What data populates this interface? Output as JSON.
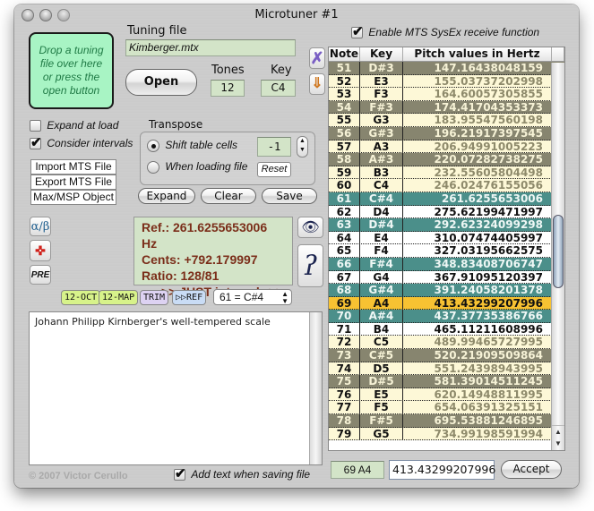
{
  "window": {
    "title": "Microtuner #1"
  },
  "dropzone": {
    "text": "Drop a tuning file over here or press the open button"
  },
  "tuning_file": {
    "label": "Tuning file",
    "value": "Kimberger.mtx",
    "open_label": "Open",
    "tones_label": "Tones",
    "tones_value": "12",
    "key_label": "Key",
    "key_value": "C4"
  },
  "side_icons": {
    "clear_icon": "x-icon",
    "download_icon": "down-arrow-icon"
  },
  "mts": {
    "enable_label": "Enable MTS SysEx receive function",
    "enable_checked": true
  },
  "options": {
    "expand_at_load_label": "Expand at load",
    "expand_at_load_checked": false,
    "consider_intervals_label": "Consider intervals",
    "consider_intervals_checked": true,
    "import_mts": "Import MTS File",
    "export_mts": "Export MTS File",
    "maxmsp": "Max/MSP Object"
  },
  "transpose": {
    "label": "Transpose",
    "shift_label": "Shift table cells",
    "shift_selected": true,
    "loading_label": "When loading file",
    "value": "-1",
    "reset_label": "Reset"
  },
  "actions": {
    "expand": "Expand",
    "clear": "Clear",
    "save": "Save"
  },
  "info": {
    "ref": "Ref.: 261.6255653006 Hz",
    "cents": "Cents: +792.179997",
    "ratio": "Ratio: 128/81",
    "interval": ">> JUST interval <<"
  },
  "left_tools": {
    "alpha_beta": "α/β",
    "pre": "PRE"
  },
  "mini_buttons": {
    "oct": "12-OCT",
    "map": "12-MAP",
    "trim": "TRIM",
    "ref": "▷▷REF",
    "ref_select": "61 = C#4"
  },
  "colors": {
    "mini_green": "#d7f28a",
    "mini_purple": "#ddd2f2",
    "mini_blue": "#c9dcf5",
    "info_text": "#7b2e1a",
    "teal_row": "#4b8f8a",
    "dim_acc_row": "#87856f",
    "selected_row": "#f7c232"
  },
  "description": "Johann Philipp Kirnberger's well-tempered scale",
  "copyright": "© 2007 Victor Cerullo",
  "add_text": {
    "label": "Add text when saving file",
    "checked": true
  },
  "table": {
    "headers": [
      "Note",
      "Key",
      "Pitch values in Hertz"
    ],
    "rows": [
      {
        "note": "51",
        "key": "D#3",
        "hz": "147.16438048159",
        "style": "dimacc"
      },
      {
        "note": "52",
        "key": "E3",
        "hz": "155.03737202998",
        "style": "dim"
      },
      {
        "note": "53",
        "key": "F3",
        "hz": "164.60057305855",
        "style": "dim"
      },
      {
        "note": "54",
        "key": "F#3",
        "hz": "174.41704353373",
        "style": "dimacc"
      },
      {
        "note": "55",
        "key": "G3",
        "hz": "183.95547560198",
        "style": "dim"
      },
      {
        "note": "56",
        "key": "G#3",
        "hz": "196.21917397545",
        "style": "dimacc"
      },
      {
        "note": "57",
        "key": "A3",
        "hz": "206.94991005223",
        "style": "dim"
      },
      {
        "note": "58",
        "key": "A#3",
        "hz": "220.07282738275",
        "style": "dimacc"
      },
      {
        "note": "59",
        "key": "B3",
        "hz": "232.55605804498",
        "style": "dim"
      },
      {
        "note": "60",
        "key": "C4",
        "hz": "246.02476155056",
        "style": "dim"
      },
      {
        "note": "61",
        "key": "C#4",
        "hz": "261.6255653006",
        "style": "teal"
      },
      {
        "note": "62",
        "key": "D4",
        "hz": "275.62199471997",
        "style": "white"
      },
      {
        "note": "63",
        "key": "D#4",
        "hz": "292.62324099298",
        "style": "teal"
      },
      {
        "note": "64",
        "key": "E4",
        "hz": "310.07474405997",
        "style": "white"
      },
      {
        "note": "65",
        "key": "F4",
        "hz": "327.03195662575",
        "style": "white"
      },
      {
        "note": "66",
        "key": "F#4",
        "hz": "348.83408706747",
        "style": "teal"
      },
      {
        "note": "67",
        "key": "G4",
        "hz": "367.91095120397",
        "style": "white"
      },
      {
        "note": "68",
        "key": "G#4",
        "hz": "391.24058201378",
        "style": "teal"
      },
      {
        "note": "69",
        "key": "A4",
        "hz": "413.43299207996",
        "style": "sel"
      },
      {
        "note": "70",
        "key": "A#4",
        "hz": "437.37735386766",
        "style": "teal"
      },
      {
        "note": "71",
        "key": "B4",
        "hz": "465.11211608996",
        "style": "white"
      },
      {
        "note": "72",
        "key": "C5",
        "hz": "489.99465727995",
        "style": "dim"
      },
      {
        "note": "73",
        "key": "C#5",
        "hz": "520.21909509864",
        "style": "dimacc"
      },
      {
        "note": "74",
        "key": "D5",
        "hz": "551.24398943995",
        "style": "dim"
      },
      {
        "note": "75",
        "key": "D#5",
        "hz": "581.39014511245",
        "style": "dimacc"
      },
      {
        "note": "76",
        "key": "E5",
        "hz": "620.14948811995",
        "style": "dim"
      },
      {
        "note": "77",
        "key": "F5",
        "hz": "654.06391325151",
        "style": "dim"
      },
      {
        "note": "78",
        "key": "F#5",
        "hz": "695.53881246895",
        "style": "dimacc"
      },
      {
        "note": "79",
        "key": "G5",
        "hz": "734.99198591994",
        "style": "dim"
      }
    ]
  },
  "bottom": {
    "note_key": "69 A4",
    "value": "413.43299207996",
    "accept": "Accept"
  }
}
